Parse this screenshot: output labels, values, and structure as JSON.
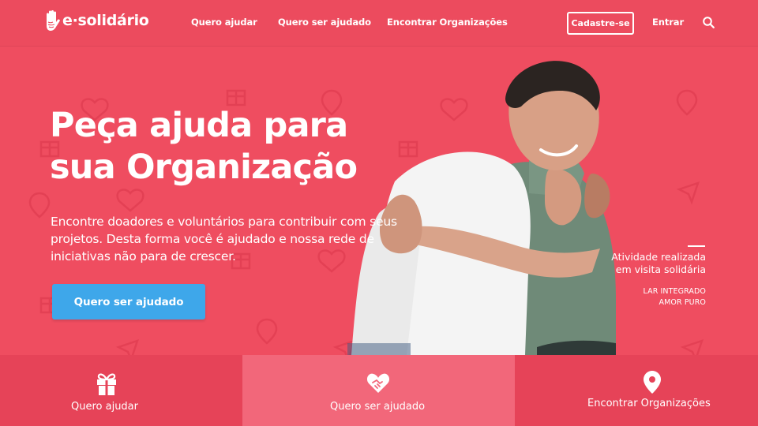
{
  "header": {
    "logo_text": "e·solidário",
    "nav": [
      {
        "label": "Quero ajudar"
      },
      {
        "label": "Quero ser ajudado"
      },
      {
        "label": "Encontrar Organizações"
      }
    ],
    "signup_label": "Cadastre-se",
    "login_label": "Entrar",
    "search_icon": "search-icon"
  },
  "hero": {
    "title_line1": "Peça ajuda para",
    "title_line2": "sua Organização",
    "description": "Encontre doadores e voluntários para contribuir com seus projetos. Desta forma você é ajudado e nossa rede de iniciativas não para de crescer.",
    "cta_label": "Quero ser ajudado"
  },
  "caption": {
    "line1": "Atividade realizada",
    "line2": "em visita solidária",
    "sub1": "LAR INTEGRADO",
    "sub2": "AMOR PURO"
  },
  "tabs": [
    {
      "label": "Quero ajudar",
      "icon": "gift-icon",
      "active": false
    },
    {
      "label": "Quero ser ajudado",
      "icon": "heart-handshake-icon",
      "active": true
    },
    {
      "label": "Encontrar Organizações",
      "icon": "map-pin-icon",
      "active": false
    }
  ],
  "colors": {
    "primary_bg": "#ef4d60",
    "tab_bg": "#e64358",
    "tab_active_bg": "#f2677a",
    "cta_bg": "#3ea7ea",
    "text": "#ffffff"
  }
}
